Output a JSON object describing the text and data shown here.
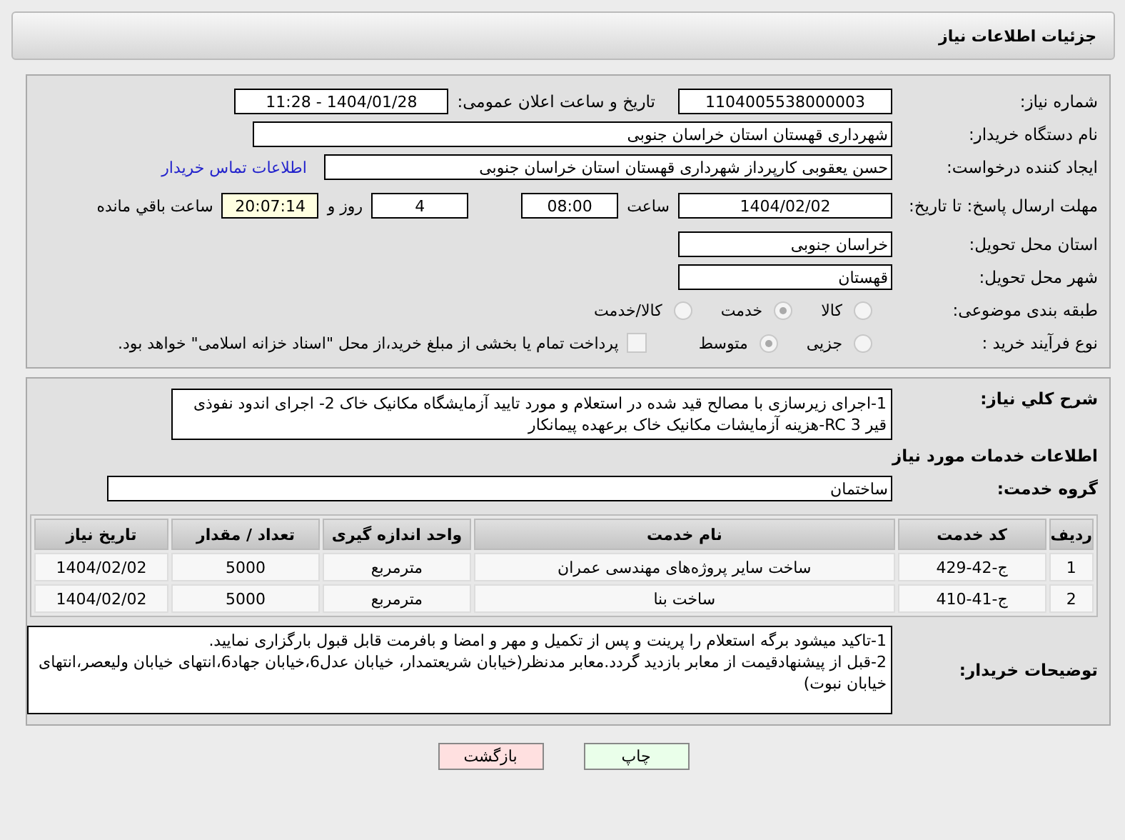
{
  "header": {
    "title": "جزئیات اطلاعات نیاز"
  },
  "details": {
    "need_number": {
      "label": "شماره نیاز:",
      "value": "1104005538000003"
    },
    "announce": {
      "label": "تاریخ و ساعت اعلان عمومی:",
      "value": "1404/01/28 - 11:28"
    },
    "buyer": {
      "label": "نام دستگاه خریدار:",
      "value": "شهرداری قهستان استان خراسان جنوبی"
    },
    "creator": {
      "label": "ایجاد کننده درخواست:",
      "value": "حسن یعقوبی کارپرداز شهرداری قهستان استان خراسان جنوبی"
    },
    "contact_link": "اطلاعات تماس خریدار",
    "deadline": {
      "label": "مهلت ارسال پاسخ: تا تاریخ:",
      "date": "1404/02/02",
      "time_label": "ساعت",
      "time": "08:00",
      "days": "4",
      "days_label": "روز و",
      "remaining": "20:07:14",
      "remaining_label": "ساعت باقي مانده"
    },
    "province": {
      "label": "استان محل تحویل:",
      "value": "خراسان جنوبی"
    },
    "city": {
      "label": "شهر محل تحویل:",
      "value": "قهستان"
    },
    "category": {
      "label": "طبقه بندی موضوعی:",
      "options": [
        {
          "label": "کالا",
          "selected": false
        },
        {
          "label": "خدمت",
          "selected": true
        },
        {
          "label": "کالا/خدمت",
          "selected": false
        }
      ]
    },
    "purchase_type": {
      "label": "نوع فرآیند خرید :",
      "options": [
        {
          "label": "جزیی",
          "selected": false
        },
        {
          "label": "متوسط",
          "selected": true
        }
      ],
      "payment": {
        "checked": false,
        "text": "پرداخت تمام یا بخشی از مبلغ خرید،از محل \"اسناد خزانه اسلامی\" خواهد بود."
      }
    }
  },
  "summary": {
    "label": "شرح کلي نیاز:",
    "text": "1-اجرای زیرسازی با مصالح قید شده در استعلام و مورد تایید آزمایشگاه مکانیک خاک 2- اجرای اندود نفوذی قیر RC 3-هزینه آزمایشات مکانیک خاک برعهده پیمانکار"
  },
  "services": {
    "title": "اطلاعات خدمات مورد نیاز",
    "group": {
      "label": "گروه خدمت:",
      "value": "ساختمان"
    },
    "table": {
      "columns": [
        "ردیف",
        "کد خدمت",
        "نام خدمت",
        "واحد اندازه گیری",
        "تعداد / مقدار",
        "تاریخ نیاز"
      ],
      "rows": [
        [
          "1",
          "ج-42-429",
          "ساخت سایر پروژه‌های مهندسی عمران",
          "مترمربع",
          "5000",
          "1404/02/02"
        ],
        [
          "2",
          "ج-41-410",
          "ساخت بنا",
          "مترمربع",
          "5000",
          "1404/02/02"
        ]
      ]
    }
  },
  "buyer_notes": {
    "label": "توضیحات خریدار:",
    "lines": [
      "1-تاکید میشود برگه استعلام را پرینت و پس از تکمیل و مهر و امضا و بافرمت قابل قبول بارگزاری نمایید.",
      "2-قبل از پیشنهادقیمت از معابر بازدید گردد.معابر مدنظر(خیابان شریعتمدار، خیابان عدل6،خیابان جهاد6،انتهای خیابان ولیعصر،انتهای خیابان نبوت)"
    ]
  },
  "buttons": [
    {
      "label": "چاپ",
      "kind": "print"
    },
    {
      "label": "بازگشت",
      "kind": "back"
    }
  ]
}
